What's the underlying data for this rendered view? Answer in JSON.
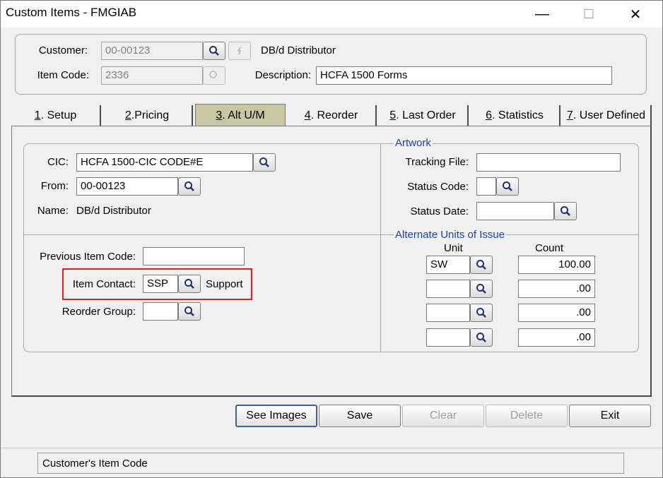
{
  "window": {
    "title": "Custom Items - FMGIAB",
    "minimize": "—",
    "maximize": "☐",
    "close": "✕"
  },
  "header": {
    "customer_label": "Customer:",
    "customer_value": "00-00123",
    "customer_name": "DB/d Distributor",
    "item_code_label": "Item Code:",
    "item_code_value": "2336",
    "description_label": "Description:",
    "description_value": "HCFA 1500 Forms"
  },
  "tabs": [
    {
      "key": "1",
      "label": ". Setup"
    },
    {
      "key": "2",
      "label": " .Pricing"
    },
    {
      "key": "3",
      "label": ". Alt U/M"
    },
    {
      "key": "4",
      "label": ". Reorder"
    },
    {
      "key": "5",
      "label": ". Last Order"
    },
    {
      "key": "6",
      "label": ". Statistics"
    },
    {
      "key": "7",
      "label": ". User Defined"
    }
  ],
  "left": {
    "cic_label": "CIC:",
    "cic_value": "HCFA 1500-CIC CODE#E",
    "from_label": "From:",
    "from_value": "00-00123",
    "name_label": "Name:",
    "name_value": "DB/d Distributor",
    "prev_item_label": "Previous Item Code:",
    "prev_item_value": "",
    "item_contact_label": "Item Contact:",
    "item_contact_value": "SSP",
    "item_contact_name": "Support",
    "reorder_group_label": "Reorder Group:",
    "reorder_group_value": ""
  },
  "artwork": {
    "title": "Artwork",
    "tracking_file_label": "Tracking File:",
    "tracking_file_value": "",
    "status_code_label": "Status Code:",
    "status_code_value": "",
    "status_date_label": "Status Date:",
    "status_date_value": ""
  },
  "alternate_units": {
    "title": "Alternate Units of Issue",
    "unit_header": "Unit",
    "count_header": "Count",
    "rows": [
      {
        "unit": "SW",
        "count": "100.00"
      },
      {
        "unit": "",
        "count": ".00"
      },
      {
        "unit": "",
        "count": ".00"
      },
      {
        "unit": "",
        "count": ".00"
      }
    ]
  },
  "buttons": {
    "see_images": "See Images",
    "save": "Save",
    "clear": "Clear",
    "delete": "Delete",
    "exit": "Exit"
  },
  "status_bar": {
    "text": "Customer's Item Code"
  },
  "icons": {
    "lookup": "magnifier-icon"
  },
  "colors": {
    "active_tab": "#c9c7a3",
    "section_title": "#1a3fbf",
    "highlight": "#e02020"
  }
}
